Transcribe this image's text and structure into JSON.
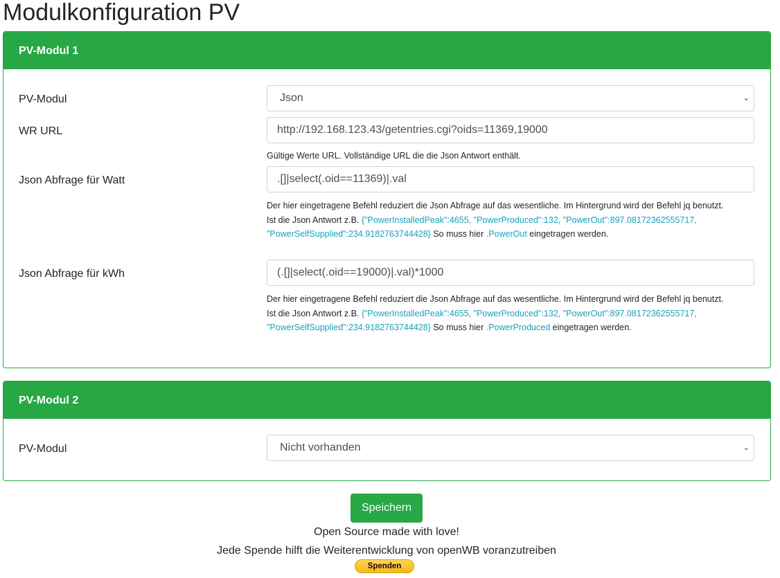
{
  "title": "Modulkonfiguration PV",
  "module1": {
    "header": "PV-Modul 1",
    "pv_modul_label": "PV-Modul",
    "pv_modul_value": "Json",
    "url_label": "WR URL",
    "url_value": "http://192.168.123.43/getentries.cgi?oids=11369,19000",
    "url_help": "Gültige Werte URL. Vollständige URL die die Json Antwort enthält.",
    "watt_label": "Json Abfrage für Watt",
    "watt_value": ".[]|select(.oid==11369)|.val",
    "kwh_label": "Json Abfrage für kWh",
    "kwh_value": "(.[]|select(.oid==19000)|.val)*1000",
    "help_line1": "Der hier eingetragene Befehl reduziert die Json Abfrage auf das wesentliche. Im Hintergrund wird der Befehl jq benutzt.",
    "help_prefix": "Ist die Json Antwort z.B. ",
    "help_example": "{\"PowerInstalledPeak\":4655, \"PowerProduced\":132, \"PowerOut\":897.08172362555717, \"PowerSelfSupplied\":234.9182763744428}",
    "help_mid": " So muss hier ",
    "watt_key": ".PowerOut",
    "kwh_key": ".PowerProduced",
    "help_suffix": " eingetragen werden."
  },
  "module2": {
    "header": "PV-Modul 2",
    "pv_modul_label": "PV-Modul",
    "pv_modul_value": "Nicht vorhanden"
  },
  "save_label": "Speichern",
  "footer_line1": "Open Source made with love!",
  "footer_line2": "Jede Spende hilft die Weiterentwicklung von openWB voranzutreiben",
  "donate_label": "Spenden",
  "accent": "#28a745"
}
